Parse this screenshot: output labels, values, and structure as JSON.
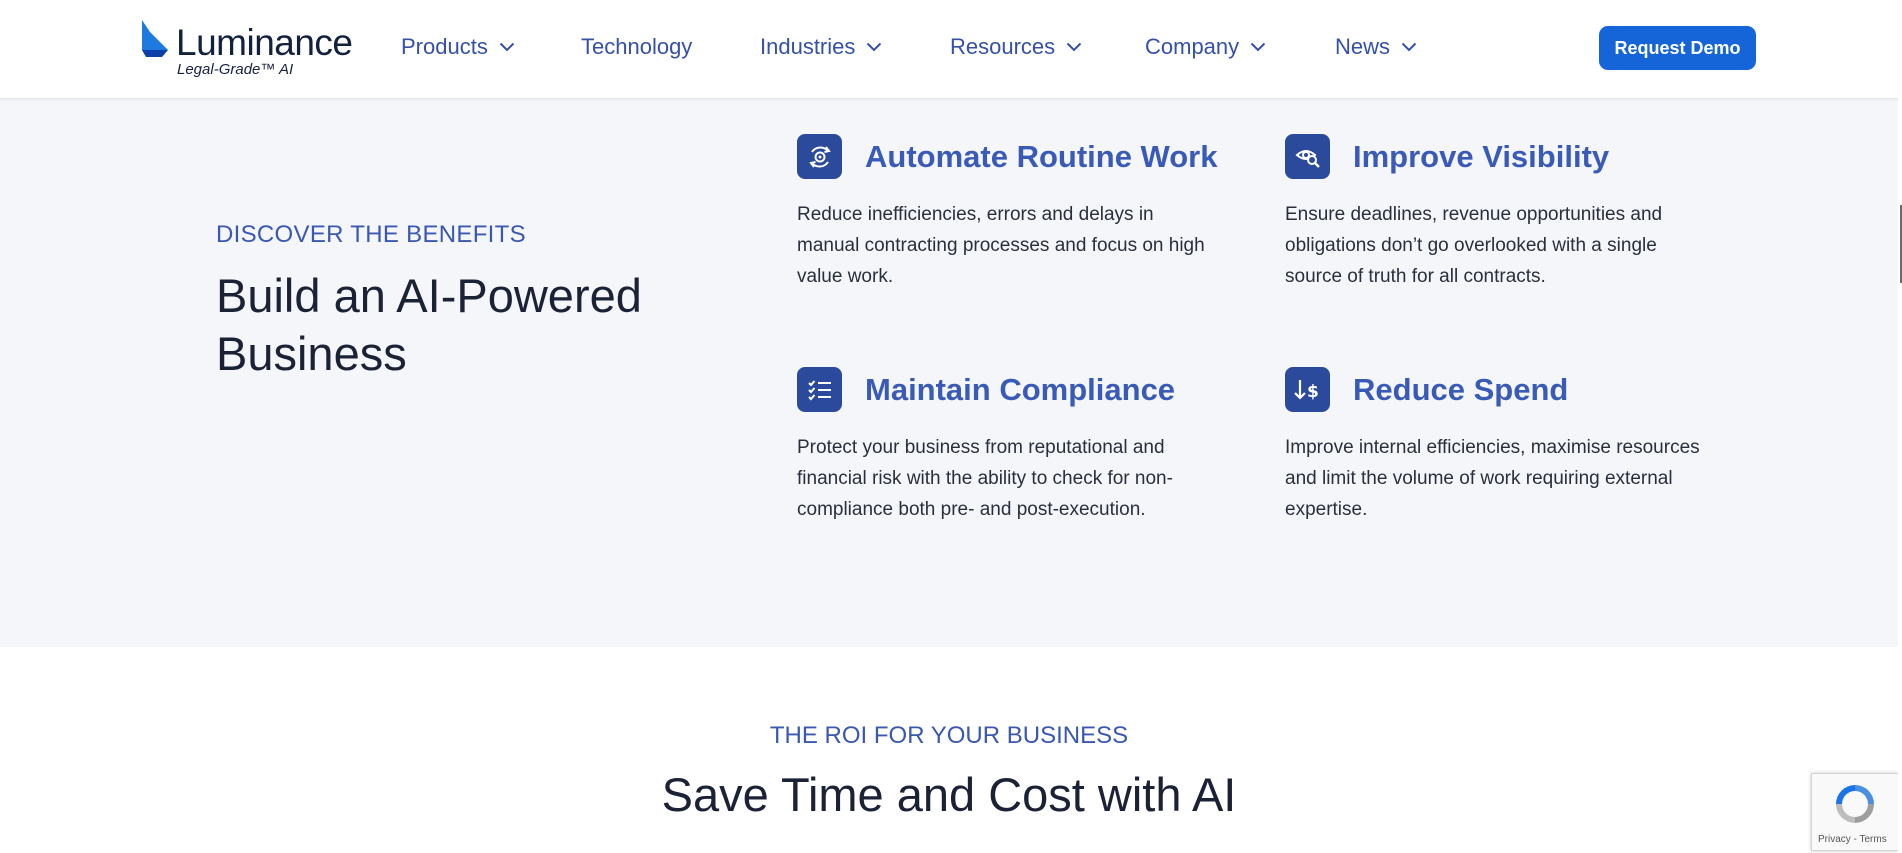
{
  "nav": {
    "logo": {
      "name": "Luminance",
      "tagline": "Legal-Grade™ AI"
    },
    "items": [
      {
        "label": "Products",
        "has_dropdown": true
      },
      {
        "label": "Technology",
        "has_dropdown": false
      },
      {
        "label": "Industries",
        "has_dropdown": true
      },
      {
        "label": "Resources",
        "has_dropdown": true
      },
      {
        "label": "Company",
        "has_dropdown": true
      },
      {
        "label": "News",
        "has_dropdown": true
      }
    ],
    "cta": "Request Demo"
  },
  "benefits": {
    "eyebrow": "DISCOVER THE BENEFITS",
    "title": "Build an AI-Powered Business",
    "cards": [
      {
        "icon": "gear-cycle-icon",
        "title": "Automate Routine Work",
        "body": "Reduce inefficiencies, errors and delays in manual contracting processes and focus on high value work."
      },
      {
        "icon": "visibility-search-icon",
        "title": "Improve Visibility",
        "body": "Ensure deadlines, revenue opportunities and obligations don’t go overlooked with a single source of truth for all contracts."
      },
      {
        "icon": "checklist-icon",
        "title": "Maintain Compliance",
        "body": "Protect your business from reputational and financial risk with the ability to check for non-compliance both pre- and post-execution."
      },
      {
        "icon": "reduce-spend-icon",
        "title": "Reduce Spend",
        "body": "Improve internal efficiencies, maximise resources and limit the volume of work requiring external expertise."
      }
    ]
  },
  "roi": {
    "eyebrow": "THE ROI FOR YOUR BUSINESS",
    "title": "Save Time and Cost with AI"
  },
  "recaptcha": {
    "links": "Privacy - Terms"
  },
  "colors": {
    "brand_blue": "#3a5ab7",
    "cta_blue": "#1565d8",
    "icon_bg": "#2c4a9c",
    "section_bg": "#f5f6f9",
    "heading_dark": "#1c2236"
  }
}
